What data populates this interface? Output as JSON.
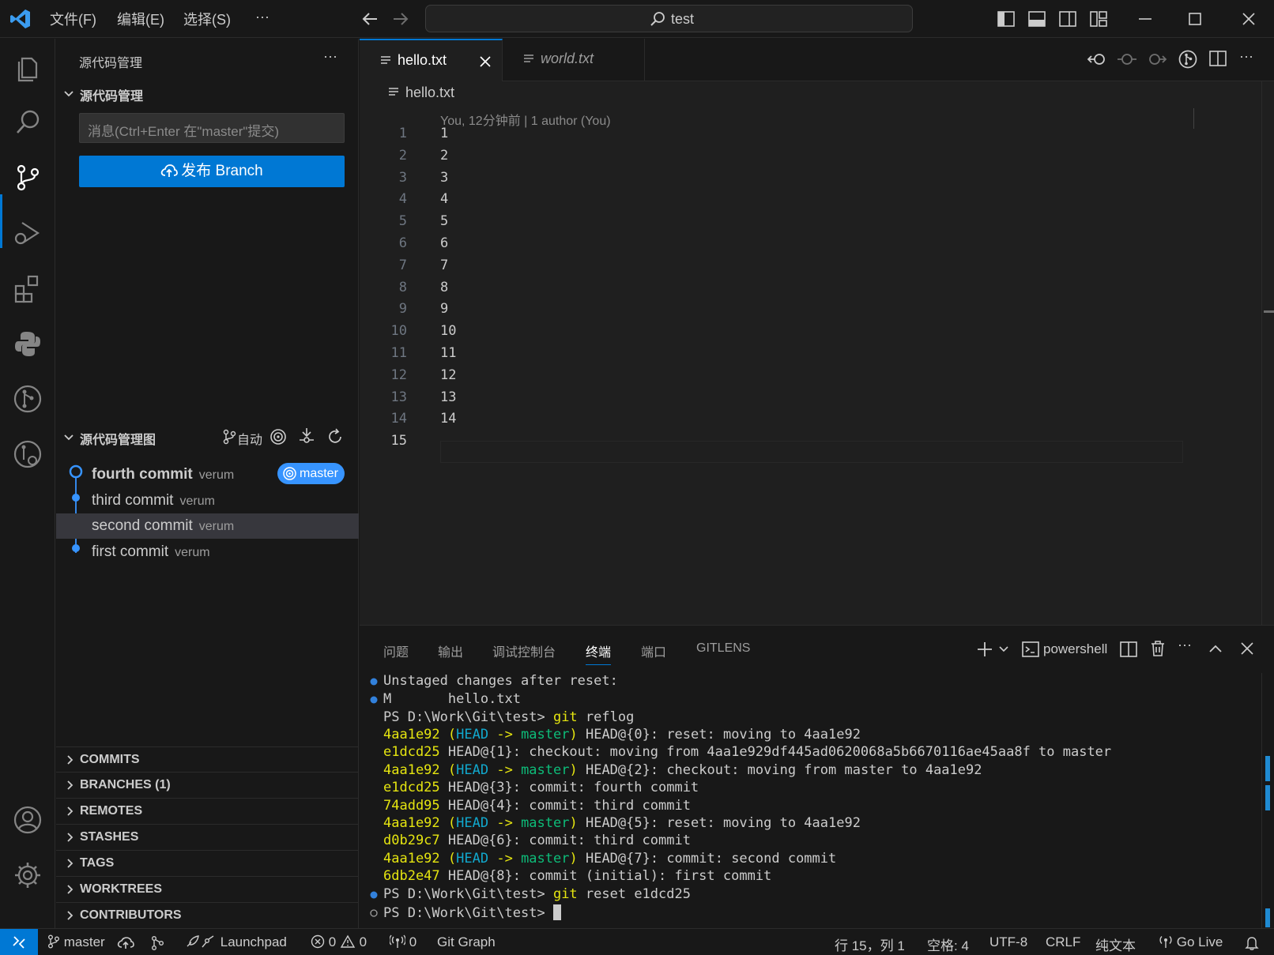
{
  "titlebar": {
    "menus": [
      "文件(F)",
      "编辑(E)",
      "选择(S)",
      "···"
    ],
    "search_text": "test"
  },
  "sidebar": {
    "header": "源代码管理",
    "scm_section": "源代码管理",
    "commit_placeholder": "消息(Ctrl+Enter 在\"master\"提交)",
    "publish_label": "发布 Branch",
    "graph_section": "源代码管理图",
    "graph_auto": "自动",
    "commits": [
      {
        "message": "fourth commit",
        "author": "verum",
        "branch": "master"
      },
      {
        "message": "third commit",
        "author": "verum"
      },
      {
        "message": "second commit",
        "author": "verum"
      },
      {
        "message": "first commit",
        "author": "verum"
      }
    ],
    "sections": [
      "COMMITS",
      "BRANCHES (1)",
      "REMOTES",
      "STASHES",
      "TAGS",
      "WORKTREES",
      "CONTRIBUTORS"
    ]
  },
  "editor": {
    "tabs": [
      {
        "label": "hello.txt",
        "active": true
      },
      {
        "label": "world.txt",
        "active": false
      }
    ],
    "breadcrumb": "hello.txt",
    "blame": "You, 12分钟前 | 1 author (You)",
    "lines": [
      "1",
      "2",
      "3",
      "4",
      "5",
      "6",
      "7",
      "8",
      "9",
      "10",
      "11",
      "12",
      "13",
      "14",
      ""
    ],
    "line_numbers": [
      "1",
      "2",
      "3",
      "4",
      "5",
      "6",
      "7",
      "8",
      "9",
      "10",
      "11",
      "12",
      "13",
      "14",
      "15"
    ]
  },
  "panel": {
    "tabs": [
      "问题",
      "输出",
      "调试控制台",
      "终端",
      "端口",
      "GITLENS"
    ],
    "active_tab": "终端",
    "shell": "powershell",
    "terminal": {
      "l1": "Unstaged changes after reset:",
      "l2a": "M",
      "l2b": "hello.txt",
      "prompt": "PS D:\\Work\\Git\\test>",
      "cmd1_git": "git",
      "cmd1_rest": " reflog",
      "reflog": [
        {
          "hash": "4aa1e92",
          "ref": true,
          "text": " HEAD@{0}: reset: moving to 4aa1e92"
        },
        {
          "hash": "e1dcd25",
          "ref": false,
          "text": " HEAD@{1}: checkout: moving from 4aa1e929df445ad0620068a5b6670116ae45aa8f to master"
        },
        {
          "hash": "4aa1e92",
          "ref": true,
          "text": " HEAD@{2}: checkout: moving from master to 4aa1e92"
        },
        {
          "hash": "e1dcd25",
          "ref": false,
          "text": " HEAD@{3}: commit: fourth commit"
        },
        {
          "hash": "74add95",
          "ref": false,
          "text": " HEAD@{4}: commit: third commit"
        },
        {
          "hash": "4aa1e92",
          "ref": true,
          "text": " HEAD@{5}: reset: moving to 4aa1e92"
        },
        {
          "hash": "d0b29c7",
          "ref": false,
          "text": " HEAD@{6}: commit: third commit"
        },
        {
          "hash": "4aa1e92",
          "ref": true,
          "text": " HEAD@{7}: commit: second commit"
        },
        {
          "hash": "6db2e47",
          "ref": false,
          "text": " HEAD@{8}: commit (initial): first commit"
        }
      ],
      "cmd2_git": "git",
      "cmd2_rest": " reset e1dcd25",
      "ref_open": "(",
      "ref_head": "HEAD",
      "ref_arrow": " -> ",
      "ref_master": "master",
      "ref_close": ")"
    }
  },
  "statusbar": {
    "branch": "master",
    "launchpad": "Launchpad",
    "errors": "0",
    "warnings": "0",
    "ports": "0",
    "git_graph": "Git Graph",
    "position": "行 15，列 1",
    "spaces": "空格: 4",
    "encoding": "UTF-8",
    "eol": "CRLF",
    "language": "纯文本",
    "golive": "Go Live"
  },
  "colors": {
    "accent": "#0078d4",
    "commit_dot": "#3794ff",
    "terminal_yellow": "#e5e510",
    "terminal_cyan": "#11a8cd",
    "terminal_green": "#0dbc79"
  }
}
